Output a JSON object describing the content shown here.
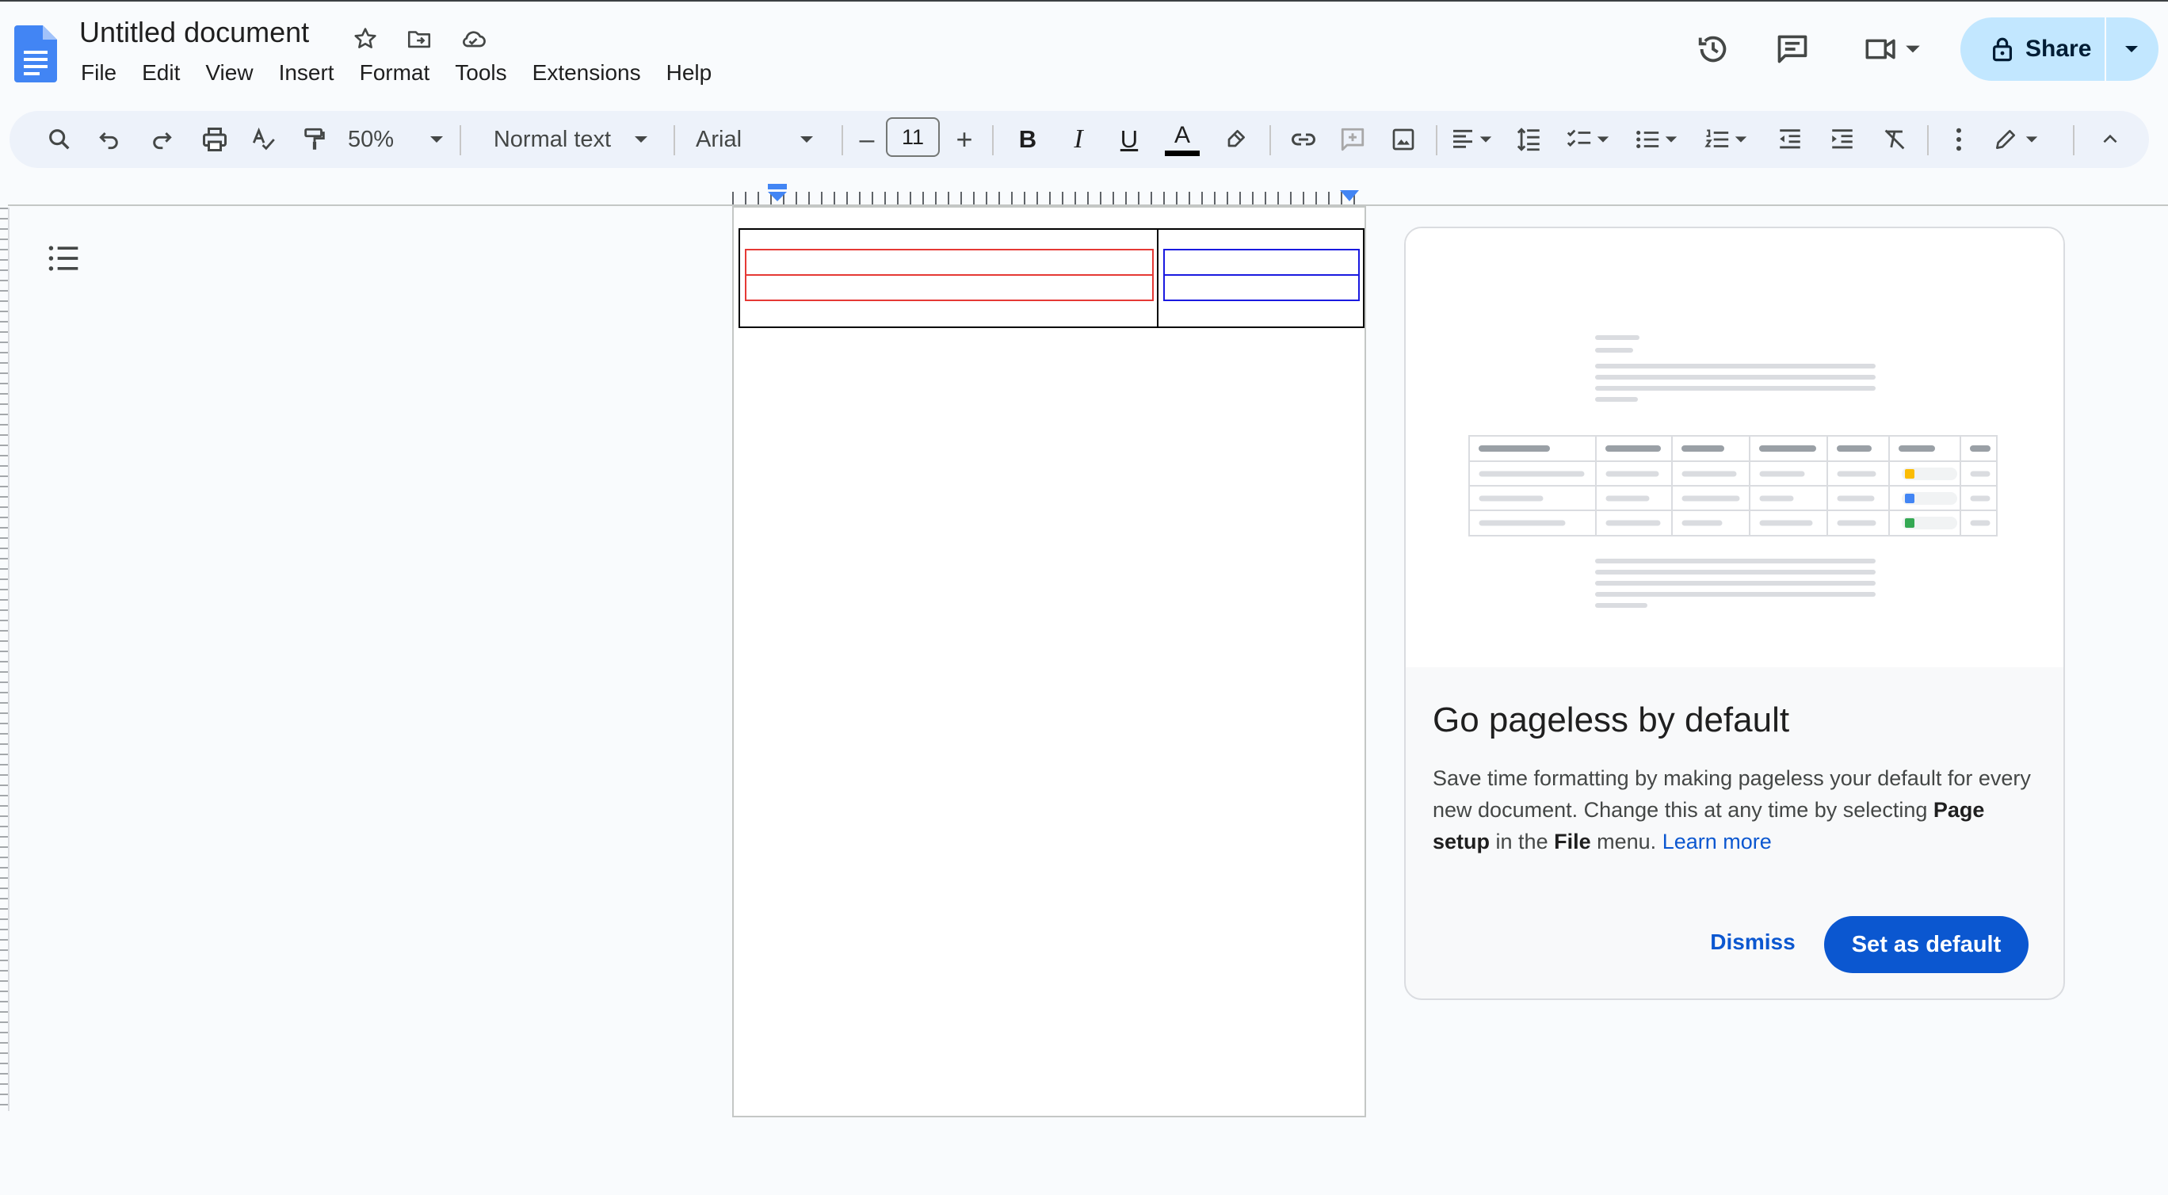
{
  "app": {
    "title": "Untitled document",
    "logo_icon": "google-docs-logo",
    "accent_color": "#0b57d0",
    "logo_color": "#4285f4"
  },
  "menubar": [
    "File",
    "Edit",
    "View",
    "Insert",
    "Format",
    "Tools",
    "Extensions",
    "Help"
  ],
  "header": {
    "share_label": "Share",
    "icons": [
      "version-history-icon",
      "comments-icon",
      "meet-icon",
      "lock-icon"
    ]
  },
  "toolbar": {
    "zoom": "50%",
    "style": "Normal text",
    "font": "Arial",
    "font_size": "11",
    "decrease_label": "–",
    "increase_label": "+",
    "bold_label": "B",
    "italic_label": "I",
    "underline_label": "U",
    "text_color_label": "A",
    "text_color": "#000000"
  },
  "document": {
    "table_cell_left_color": "#e53935",
    "table_cell_right_color": "#1a1ae0"
  },
  "card": {
    "title": "Go pageless by default",
    "body_1": "Save time formatting by making pageless your default for every new document. Change this at any time by selecting",
    "bold_1": "Page setup",
    "body_2": "in the",
    "bold_2": "File",
    "body_3": "menu.",
    "link": "Learn more",
    "dismiss_label": "Dismiss",
    "default_label": "Set as default",
    "illustration_dot_colors": [
      "#fbbc04",
      "#4285f4",
      "#34a853"
    ]
  }
}
